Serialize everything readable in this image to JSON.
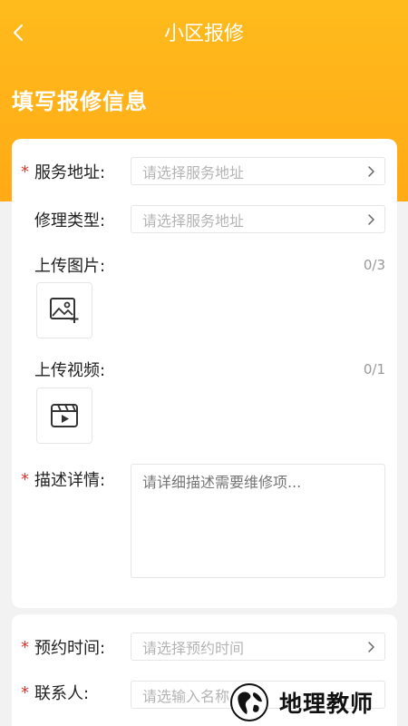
{
  "nav": {
    "title": "小区报修"
  },
  "section": {
    "title": "填写报修信息"
  },
  "form": {
    "address": {
      "label": "服务地址:",
      "placeholder": "请选择服务地址"
    },
    "repair_type": {
      "label": "修理类型:",
      "placeholder": "请选择服务地址"
    },
    "upload_image": {
      "label": "上传图片:",
      "counter": "0/3"
    },
    "upload_video": {
      "label": "上传视频:",
      "counter": "0/1"
    },
    "description": {
      "label": "描述详情:",
      "placeholder": "请详细描述需要维修项..."
    }
  },
  "form2": {
    "appointment": {
      "label": "预约时间:",
      "placeholder": "请选择预约时间"
    },
    "contact": {
      "label": "联系人:",
      "placeholder": "请选输入名称"
    }
  },
  "required_mark": "*",
  "watermark": {
    "text": "地理教师"
  },
  "colors": {
    "primary": "#ffb31a",
    "required": "#e8322c",
    "placeholder": "#b4b4b4"
  }
}
